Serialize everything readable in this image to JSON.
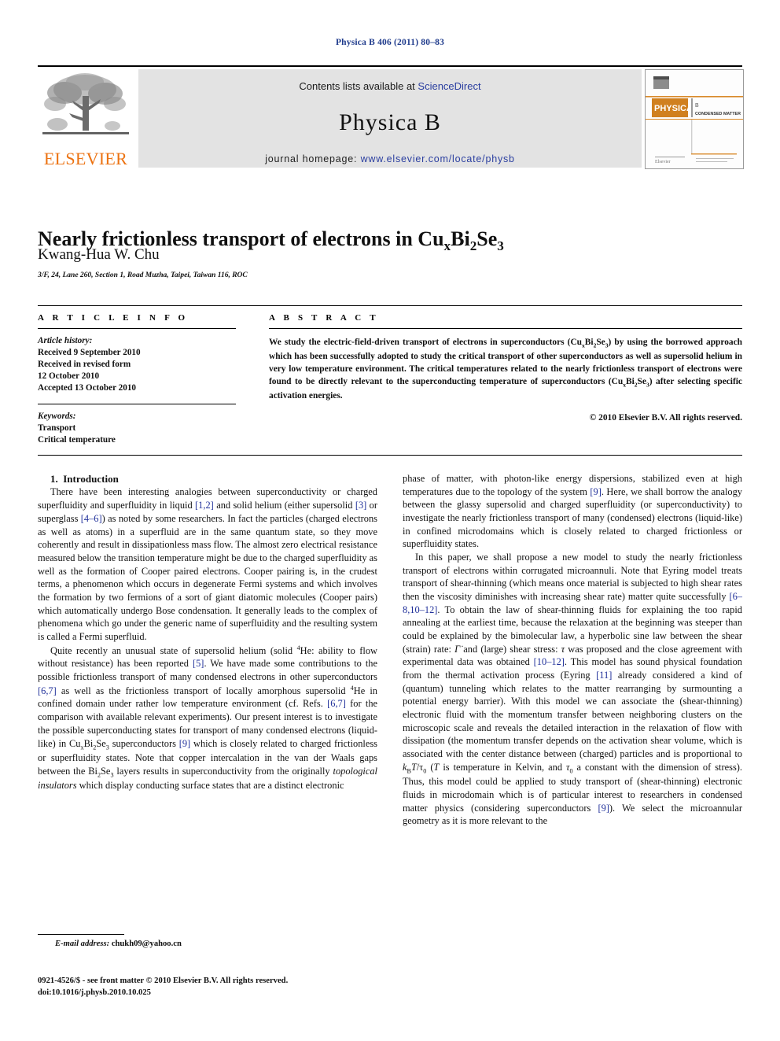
{
  "running_head": "Physica B 406 (2011) 80–83",
  "masthead": {
    "publisher_name": "ELSEVIER",
    "contents_prefix": "Contents lists available at ",
    "sciencedirect": "ScienceDirect",
    "journal_name": "Physica B",
    "homepage_prefix": "journal homepage: ",
    "homepage_url": "www.elsevier.com/locate/physb",
    "cover": {
      "brand": "PHYSICA",
      "subtitle": "CONDENSED MATTER",
      "volume_mark": "B",
      "footer_brand": "Elsevier"
    },
    "accent_orange": "#ec7211",
    "link_blue": "#2b3fa0",
    "banner_gray": "#e3e3e3"
  },
  "article": {
    "title_prefix": "Nearly frictionless transport of electrons in Cu",
    "title_sub1": "x",
    "title_mid": "Bi",
    "title_sub2": "2",
    "title_mid2": "Se",
    "title_sub3": "3",
    "author": "Kwang-Hua W. Chu",
    "affiliation": "3/F, 24, Lane 260, Section 1, Road Muzha, Taipei, Taiwan 116, ROC"
  },
  "info": {
    "heading": "A R T I C L E   I N F O",
    "history_label": "Article history:",
    "history": [
      "Received 9 September 2010",
      "Received in revised form",
      "12 October 2010",
      "Accepted 13 October 2010"
    ],
    "keywords_label": "Keywords:",
    "keywords": [
      "Transport",
      "Critical temperature"
    ]
  },
  "abstract": {
    "heading": "A B S T R A C T",
    "text_part1": "We study the electric-field-driven transport of electrons in superconductors (Cu",
    "text_part2": ") by using the borrowed approach which has been successfully adopted to study the critical transport of other superconductors as well as supersolid helium in very low temperature environment. The critical temperatures related to the nearly frictionless transport of electrons were found to be directly relevant to the superconducting temperature of superconductors (Cu",
    "text_part3": ") after selecting specific activation energies.",
    "copyright": "© 2010 Elsevier B.V. All rights reserved."
  },
  "body": {
    "section_number": "1.",
    "section_title": "Introduction",
    "left": {
      "p1_a": "There have been interesting analogies between superconductivity or charged superfluidity and superfluidity in liquid ",
      "p1_c1": "[1,2]",
      "p1_b": " and solid helium (either supersolid ",
      "p1_c2": "[3]",
      "p1_d": " or superglass ",
      "p1_c3": "[4–6]",
      "p1_e": ") as noted by some researchers. In fact the particles (charged electrons as well as atoms) in a superfluid are in the same quantum state, so they move coherently and result in dissipationless mass flow. The almost zero electrical resistance measured below the transition temperature might be due to the charged superfluidity as well as the formation of Cooper paired electrons. Cooper pairing is, in the crudest terms, a phenomenon which occurs in degenerate Fermi systems and which involves the formation by two fermions of a sort of giant diatomic molecules (Cooper pairs) which automatically undergo Bose condensation. It generally leads to the complex of phenomena which go under the generic name of superfluidity and the resulting system is called a Fermi superfluid.",
      "p2_a": "Quite recently an unusual state of supersolid helium (solid ",
      "p2_sup1": "4",
      "p2_b": "He: ability to flow without resistance) has been reported ",
      "p2_c1": "[5]",
      "p2_c": ". We have made some contributions to the possible frictionless transport of many condensed electrons in other superconductors ",
      "p2_c2": "[6,7]",
      "p2_d": " as well as the frictionless transport of locally amorphous supersolid ",
      "p2_sup2": "4",
      "p2_e": "He in confined domain under rather low temperature environment (cf. Refs. ",
      "p2_c3": "[6,7]",
      "p2_f": " for the comparison with available relevant experiments). Our present interest is to investigate the possible superconducting states for transport of many condensed electrons (liquid-like) in Cu",
      "p2_sub1": "x",
      "p2_g": "Bi",
      "p2_sub2": "2",
      "p2_h": "Se",
      "p2_sub3": "3",
      "p2_i": " superconductors ",
      "p2_c4": "[9]",
      "p2_j": " which is closely related to charged frictionless or superfluidity states. Note that copper intercalation in the van der Waals gaps between the Bi",
      "p2_sub4": "2",
      "p2_k": "Se",
      "p2_sub5": "3",
      "p2_l": " layers results in superconductivity from the originally ",
      "p2_em": "topological insulators",
      "p2_m": " which display conducting surface states that are a distinct electronic"
    },
    "right": {
      "p1_a": "phase of matter, with photon-like energy dispersions, stabilized even at high temperatures due to the topology of the system ",
      "p1_c1": "[9]",
      "p1_b": ". Here, we shall borrow the analogy between the glassy supersolid and charged superfluidity (or superconductivity) to investigate the nearly frictionless transport of many (condensed) electrons (liquid-like) in confined microdomains which is closely related to charged frictionless or superfluidity states.",
      "p2_a": "In this paper, we shall propose a new model to study the nearly frictionless transport of electrons within corrugated microannuli. Note that Eyring model treats transport of shear-thinning (which means once material is subjected to high shear rates then the viscosity diminishes with increasing shear rate) matter quite successfully ",
      "p2_c1": "[6–8,10–12]",
      "p2_b": ". To obtain the law of shear-thinning fluids for explaining the too rapid annealing at the earliest time, because the relaxation at the beginning was steeper than could be explained by the bimolecular law, a hyperbolic sine law between the shear (strain) rate: ",
      "p2_sym1": "Γ̇",
      "p2_c": " and (large) shear stress: ",
      "p2_sym2": "τ",
      "p2_d": " was proposed and the close agreement with experimental data was obtained ",
      "p2_c2": "[10–12]",
      "p2_e": ". This model has sound physical foundation from the thermal activation process (Eyring ",
      "p2_c3": "[11]",
      "p2_f": " already considered a kind of (quantum) tunneling which relates to the matter rearranging by surmounting a potential energy barrier). With this model we can associate the (shear-thinning) electronic fluid with the momentum transfer between neighboring clusters on the microscopic scale and reveals the detailed interaction in the relaxation of flow with dissipation (the momentum transfer depends on the activation shear volume, which is associated with the center distance between (charged) particles and is proportional to ",
      "p2_formula_k": "k",
      "p2_formula_b": "B",
      "p2_formula_t": "T",
      "p2_formula_slash": "/τ",
      "p2_formula_0": "0",
      "p2_g": " (",
      "p2_em_t": "T",
      "p2_h": " is temperature in Kelvin, and ",
      "p2_sym3": "τ",
      "p2_sub0": "0",
      "p2_i": " a constant with the dimension of stress). Thus, this model could be applied to study transport of (shear-thinning) electronic fluids in microdomain which is of particular interest to researchers in condensed matter physics (considering superconductors ",
      "p2_c4": "[9]",
      "p2_j": "). We select the microannular geometry as it is more relevant to the"
    }
  },
  "footer": {
    "email_label": "E-mail address:",
    "email": "chukh09@yahoo.cn",
    "issn_line": "0921-4526/$ - see front matter © 2010 Elsevier B.V. All rights reserved.",
    "doi_line": "doi:10.1016/j.physb.2010.10.025"
  }
}
